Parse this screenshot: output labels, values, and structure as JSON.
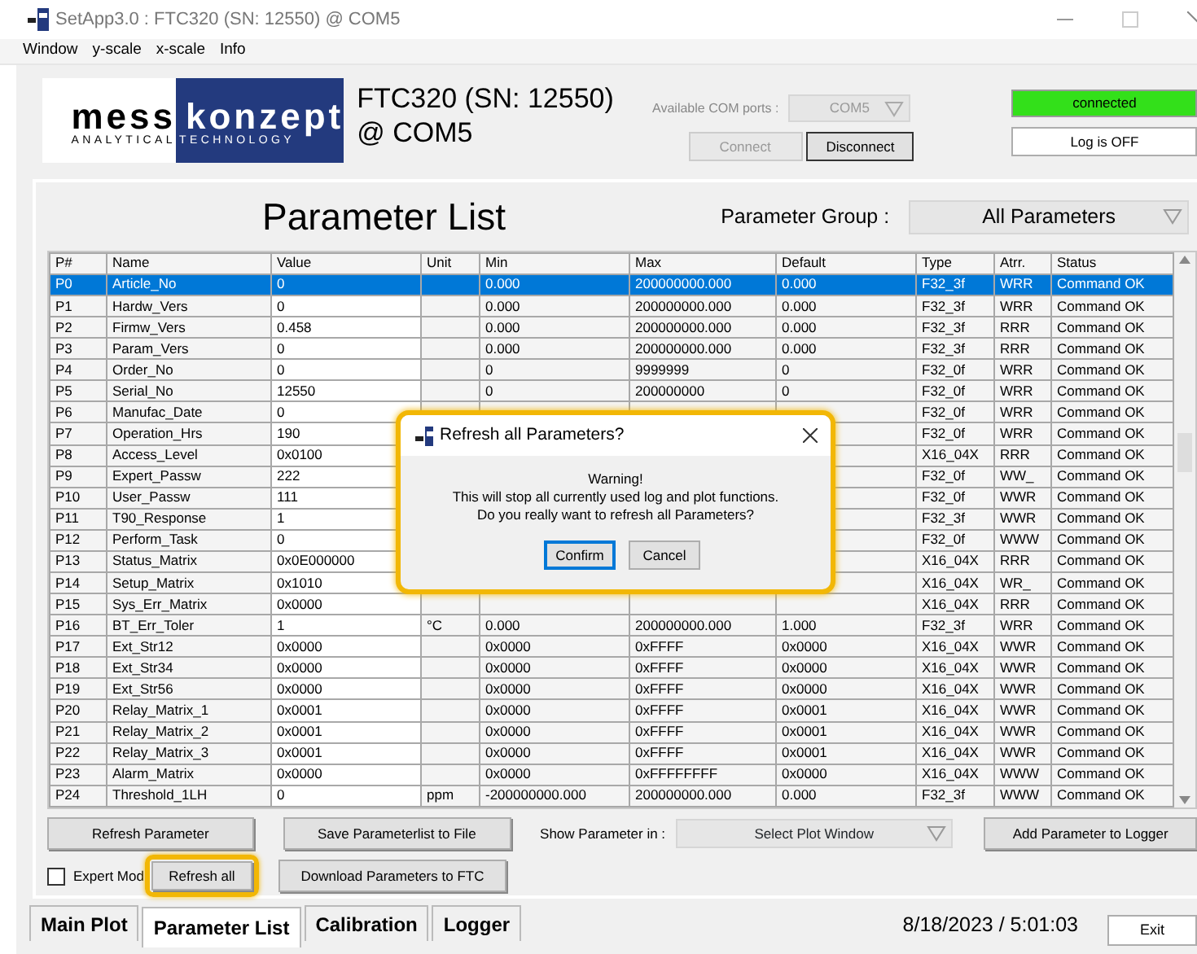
{
  "window": {
    "title": "SetApp3.0 : FTC320  (SN: 12550)  @ COM5"
  },
  "menu": [
    "Window",
    "y-scale",
    "x-scale",
    "Info"
  ],
  "logo": {
    "word_left": "mess",
    "word_right": "konzept",
    "tagline_left": "ANALYTICAL",
    "tagline_right": "TECHNOLOGY"
  },
  "device": {
    "line_1": "FTC320  (SN: 12550)",
    "line_2": "@ COM5"
  },
  "com_ports": {
    "label": "Available COM ports :",
    "value": "COM5",
    "disabled": true
  },
  "connection_buttons": [
    {
      "label": "Connect",
      "disabled": true
    },
    {
      "label": "Disconnect",
      "disabled": false
    }
  ],
  "connection_status": {
    "label": "connected",
    "color": "#33e01a"
  },
  "log_button": {
    "label": "Log is OFF"
  },
  "parameter_list": {
    "title": "Parameter List",
    "group_label": "Parameter Group :",
    "group_value": "All Parameters"
  },
  "table": {
    "columns": [
      "P#",
      "Name",
      "Value",
      "Unit",
      "Min",
      "Max",
      "Default",
      "Type",
      "Atrr.",
      "Status"
    ],
    "rows": [
      {
        "selected": true,
        "cells": [
          "P0",
          "Article_No",
          "0",
          null,
          "0.000",
          "200000000.000",
          "0.000",
          "F32_3f",
          "WRR",
          "Command OK"
        ]
      },
      {
        "selected": false,
        "cells": [
          "P1",
          "Hardw_Vers",
          "0",
          null,
          "0.000",
          "200000000.000",
          "0.000",
          "F32_3f",
          "WRR",
          "Command OK"
        ]
      },
      {
        "selected": false,
        "cells": [
          "P2",
          "Firmw_Vers",
          "0.458",
          null,
          "0.000",
          "200000000.000",
          "0.000",
          "F32_3f",
          "RRR",
          "Command OK"
        ]
      },
      {
        "selected": false,
        "cells": [
          "P3",
          "Param_Vers",
          "0",
          null,
          "0.000",
          "200000000.000",
          "0.000",
          "F32_3f",
          "RRR",
          "Command OK"
        ]
      },
      {
        "selected": false,
        "cells": [
          "P4",
          "Order_No",
          "0",
          null,
          "0",
          "9999999",
          "0",
          "F32_0f",
          "WRR",
          "Command OK"
        ]
      },
      {
        "selected": false,
        "cells": [
          "P5",
          "Serial_No",
          "12550",
          null,
          "0",
          "200000000",
          "0",
          "F32_0f",
          "WRR",
          "Command OK"
        ]
      },
      {
        "selected": false,
        "cells": [
          "P6",
          "Manufac_Date",
          "0",
          null,
          null,
          null,
          null,
          "F32_0f",
          "WRR",
          "Command OK"
        ]
      },
      {
        "selected": false,
        "cells": [
          "P7",
          "Operation_Hrs",
          "190",
          null,
          null,
          null,
          null,
          "F32_0f",
          "WRR",
          "Command OK"
        ]
      },
      {
        "selected": false,
        "cells": [
          "P8",
          "Access_Level",
          "0x0100",
          null,
          null,
          null,
          null,
          "X16_04X",
          "RRR",
          "Command OK"
        ]
      },
      {
        "selected": false,
        "cells": [
          "P9",
          "Expert_Passw",
          "222",
          null,
          null,
          null,
          null,
          "F32_0f",
          "WW_",
          "Command OK"
        ]
      },
      {
        "selected": false,
        "cells": [
          "P10",
          "User_Passw",
          "111",
          null,
          null,
          null,
          null,
          "F32_0f",
          "WWR",
          "Command OK"
        ]
      },
      {
        "selected": false,
        "cells": [
          "P11",
          "T90_Response",
          "1",
          null,
          null,
          null,
          null,
          "F32_3f",
          "WWR",
          "Command OK"
        ]
      },
      {
        "selected": false,
        "cells": [
          "P12",
          "Perform_Task",
          "0",
          null,
          null,
          null,
          null,
          "F32_0f",
          "WWW",
          "Command OK"
        ]
      },
      {
        "selected": false,
        "cells": [
          "P13",
          "Status_Matrix",
          "0x0E000000",
          null,
          null,
          null,
          null,
          "X16_04X",
          "RRR",
          "Command OK"
        ]
      },
      {
        "selected": false,
        "cells": [
          "P14",
          "Setup_Matrix",
          "0x1010",
          null,
          null,
          null,
          null,
          "X16_04X",
          "WR_",
          "Command OK"
        ]
      },
      {
        "selected": false,
        "cells": [
          "P15",
          "Sys_Err_Matrix",
          "0x0000",
          null,
          null,
          null,
          null,
          "X16_04X",
          "RRR",
          "Command OK"
        ]
      },
      {
        "selected": false,
        "cells": [
          "P16",
          "BT_Err_Toler",
          "1",
          "°C",
          "0.000",
          "200000000.000",
          "1.000",
          "F32_3f",
          "WRR",
          "Command OK"
        ]
      },
      {
        "selected": false,
        "cells": [
          "P17",
          "Ext_Str12",
          "0x0000",
          null,
          "0x0000",
          "0xFFFF",
          "0x0000",
          "X16_04X",
          "WWR",
          "Command OK"
        ]
      },
      {
        "selected": false,
        "cells": [
          "P18",
          "Ext_Str34",
          "0x0000",
          null,
          "0x0000",
          "0xFFFF",
          "0x0000",
          "X16_04X",
          "WWR",
          "Command OK"
        ]
      },
      {
        "selected": false,
        "cells": [
          "P19",
          "Ext_Str56",
          "0x0000",
          null,
          "0x0000",
          "0xFFFF",
          "0x0000",
          "X16_04X",
          "WWR",
          "Command OK"
        ]
      },
      {
        "selected": false,
        "cells": [
          "P20",
          "Relay_Matrix_1",
          "0x0001",
          null,
          "0x0000",
          "0xFFFF",
          "0x0001",
          "X16_04X",
          "WWR",
          "Command OK"
        ]
      },
      {
        "selected": false,
        "cells": [
          "P21",
          "Relay_Matrix_2",
          "0x0001",
          null,
          "0x0000",
          "0xFFFF",
          "0x0001",
          "X16_04X",
          "WWR",
          "Command OK"
        ]
      },
      {
        "selected": false,
        "cells": [
          "P22",
          "Relay_Matrix_3",
          "0x0001",
          null,
          "0x0000",
          "0xFFFF",
          "0x0001",
          "X16_04X",
          "WWR",
          "Command OK"
        ]
      },
      {
        "selected": false,
        "cells": [
          "P23",
          "Alarm_Matrix",
          "0x0000",
          null,
          "0x0000",
          "0xFFFFFFFF",
          "0x0000",
          "X16_04X",
          "WWW",
          "Command OK"
        ]
      },
      {
        "selected": false,
        "cells": [
          "P24",
          "Threshold_1LH",
          "0",
          "ppm",
          "-200000000.000",
          "200000000.000",
          "0.000",
          "F32_3f",
          "WWW",
          "Command OK"
        ]
      }
    ]
  },
  "controls": {
    "refresh_parameter": "Refresh Parameter",
    "save_list": "Save Parameterlist to File",
    "show_label": "Show Parameter in :",
    "show_value": "Select Plot Window",
    "add_logger": "Add Parameter to Logger",
    "expert_mode": {
      "label": "Expert Mod",
      "checked": false
    },
    "refresh_all": {
      "label": "Refresh all",
      "highlighted": true
    },
    "download": "Download Parameters to FTC"
  },
  "tabs": [
    {
      "label": "Main Plot",
      "selected": false
    },
    {
      "label": "Parameter List",
      "selected": true
    },
    {
      "label": "Calibration",
      "selected": false
    },
    {
      "label": "Logger",
      "selected": false
    }
  ],
  "datetime": "8/18/2023 / 5:01:03",
  "exit_button": "Exit",
  "dialog": {
    "title": "Refresh all Parameters?",
    "lines": [
      "Warning!",
      "This will stop all currently used log and plot functions.",
      "Do you really want to refresh all Parameters?"
    ],
    "buttons": [
      {
        "label": "Confirm",
        "focused": true
      },
      {
        "label": "Cancel",
        "focused": false
      }
    ],
    "highlighted": true
  }
}
